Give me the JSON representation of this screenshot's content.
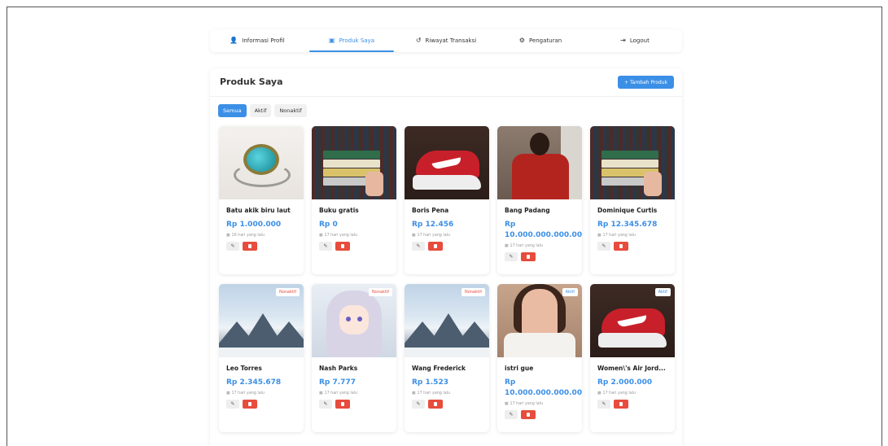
{
  "nav": {
    "items": [
      {
        "label": "Informasi Profil",
        "icon": "user-icon",
        "glyph": "👤"
      },
      {
        "label": "Produk Saya",
        "icon": "box-icon",
        "glyph": "▣"
      },
      {
        "label": "Riwayat Transaksi",
        "icon": "history-icon",
        "glyph": "↺"
      },
      {
        "label": "Pengaturan",
        "icon": "gear-icon",
        "glyph": "⚙"
      },
      {
        "label": "Logout",
        "icon": "logout-icon",
        "glyph": "⇥"
      }
    ],
    "active": "Produk Saya"
  },
  "panel": {
    "title": "Produk Saya",
    "add_button": "+ Tambah Produk",
    "filters": [
      "Semua",
      "Aktif",
      "Nonaktif"
    ],
    "active_filter": "Semua"
  },
  "products": [
    {
      "name": "Batu akik biru laut",
      "price": "Rp 1.000.000",
      "time": "16 hari yang lalu",
      "badge": "",
      "image": "ring"
    },
    {
      "name": "Buku gratis",
      "price": "Rp 0",
      "time": "17 hari yang lalu",
      "badge": "",
      "image": "books"
    },
    {
      "name": "Boris Pena",
      "price": "Rp 12.456",
      "time": "17 hari yang lalu",
      "badge": "",
      "image": "shoe"
    },
    {
      "name": "Bang Padang",
      "price": "Rp 10.000.000.000.000",
      "time": "17 hari yang lalu",
      "badge": "",
      "image": "person"
    },
    {
      "name": "Dominique Curtis",
      "price": "Rp 12.345.678",
      "time": "17 hari yang lalu",
      "badge": "",
      "image": "books"
    },
    {
      "name": "Leo Torres",
      "price": "Rp 2.345.678",
      "time": "17 hari yang lalu",
      "badge": "Nonaktif",
      "image": "mountain"
    },
    {
      "name": "Nash Parks",
      "price": "Rp 7.777",
      "time": "17 hari yang lalu",
      "badge": "Nonaktif",
      "image": "anime"
    },
    {
      "name": "Wang Frederick",
      "price": "Rp 1.523",
      "time": "17 hari yang lalu",
      "badge": "Nonaktif",
      "image": "mountain"
    },
    {
      "name": "istri gue",
      "price": "Rp 10.000.000.000.000",
      "time": "17 hari yang lalu",
      "badge": "Aktif",
      "image": "woman"
    },
    {
      "name": "Women\\'s Air Jord...",
      "price": "Rp 2.000.000",
      "time": "17 hari yang lalu",
      "badge": "Aktif",
      "image": "shoe"
    }
  ],
  "colors": {
    "accent": "#3b8fe6",
    "danger": "#e74c3c"
  }
}
